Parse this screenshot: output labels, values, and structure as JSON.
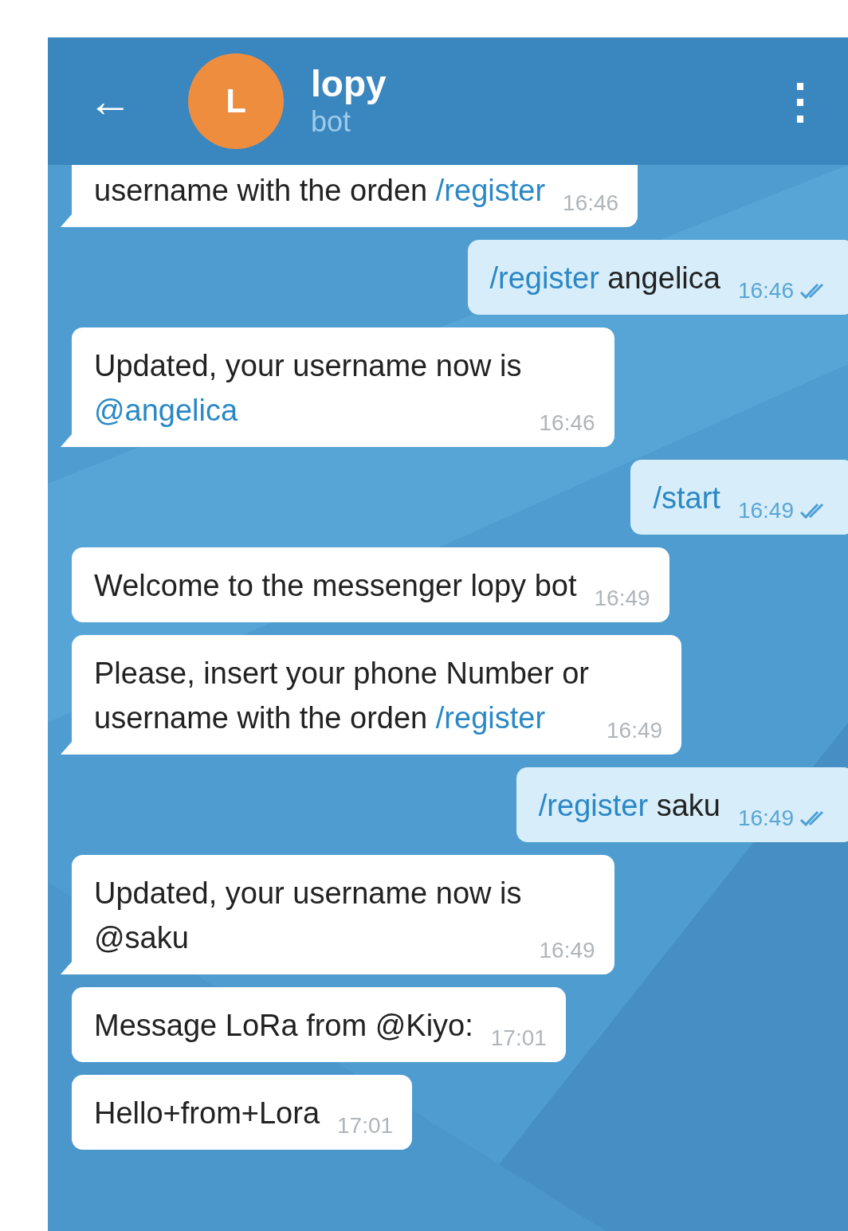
{
  "header": {
    "back": "←",
    "avatar_letter": "L",
    "title": "lopy",
    "subtitle": "bot",
    "menu": "⋮"
  },
  "messages": [
    {
      "kind": "incoming",
      "cut_top": true,
      "tail": true,
      "parts": [
        {
          "kind": "plain",
          "text": "username with the orden "
        },
        {
          "kind": "link",
          "text": "/register"
        }
      ],
      "time": "16:46"
    },
    {
      "kind": "outgoing",
      "read": true,
      "parts": [
        {
          "kind": "link",
          "text": "/register"
        },
        {
          "kind": "plain",
          "text": " angelica"
        }
      ],
      "time": "16:46"
    },
    {
      "kind": "incoming",
      "tail": true,
      "parts": [
        {
          "kind": "plain",
          "text": "Updated, your username now is\n"
        },
        {
          "kind": "link",
          "text": "@angelica"
        }
      ],
      "time": "16:46"
    },
    {
      "kind": "outgoing",
      "read": true,
      "parts": [
        {
          "kind": "link",
          "text": "/start"
        }
      ],
      "time": "16:49"
    },
    {
      "kind": "incoming",
      "tail": false,
      "parts": [
        {
          "kind": "plain",
          "text": "Welcome to the messenger lopy bot"
        }
      ],
      "time": "16:49"
    },
    {
      "kind": "incoming",
      "tail": true,
      "parts": [
        {
          "kind": "plain",
          "text": "Please, insert your phone Number or\nusername with the orden "
        },
        {
          "kind": "link",
          "text": "/register"
        }
      ],
      "time": "16:49"
    },
    {
      "kind": "outgoing",
      "read": true,
      "parts": [
        {
          "kind": "link",
          "text": "/register"
        },
        {
          "kind": "plain",
          "text": " saku"
        }
      ],
      "time": "16:49"
    },
    {
      "kind": "incoming",
      "tail": true,
      "parts": [
        {
          "kind": "plain",
          "text": "Updated, your username now is\n@saku"
        }
      ],
      "time": "16:49"
    },
    {
      "kind": "incoming",
      "tail": false,
      "parts": [
        {
          "kind": "plain",
          "text": "Message LoRa from @Kiyo:"
        }
      ],
      "time": "17:01"
    },
    {
      "kind": "incoming",
      "tail": false,
      "parts": [
        {
          "kind": "plain",
          "text": "Hello+from+Lora"
        }
      ],
      "time": "17:01"
    }
  ]
}
